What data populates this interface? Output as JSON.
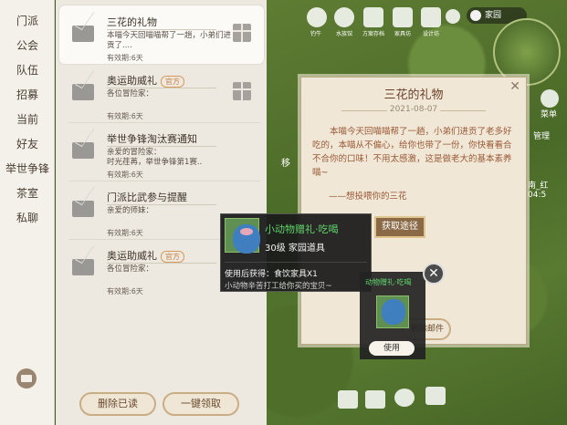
{
  "categories": [
    "门派",
    "公会",
    "队伍",
    "招募",
    "当前",
    "好友",
    "举世争锋",
    "茶室",
    "私聊"
  ],
  "mails": [
    {
      "title": "三花的礼物",
      "badge": "",
      "body": "本喵今天回喵喵帮了一趟，小弟们进贡了....",
      "expiry": "有效期:6天",
      "has_gift": true
    },
    {
      "title": "奥运助威礼",
      "badge": "官方",
      "body": "各位冒险家：",
      "expiry": "有效期:6天",
      "has_gift": true
    },
    {
      "title": "举世争锋淘汰赛通知",
      "badge": "",
      "body": "亲爱的冒险家：\n时光荏苒，举世争锋第1赛..",
      "expiry": "有效期:6天",
      "has_gift": false
    },
    {
      "title": "门派比武参与提醒",
      "badge": "",
      "body": "亲爱的师妹：",
      "expiry": "有效期:6天",
      "has_gift": false
    },
    {
      "title": "奥运助威礼",
      "badge": "官方",
      "body": "各位冒险家：",
      "expiry": "有效期:6天",
      "has_gift": false
    }
  ],
  "buttons": {
    "delete_read": "删除已读",
    "claim_all": "一键领取"
  },
  "hud": {
    "labels": [
      "钓牛",
      "水族馆",
      "方案存档",
      "家具坊",
      "设计坊",
      "菜单",
      "管理"
    ],
    "home_label": "家园"
  },
  "letter": {
    "title": "三花的礼物",
    "date": "2021-08-07",
    "body": "本喵今天回喵喵帮了一趟，小弟们进贡了老多好吃的，本喵从不偏心，给你也带了一份，你快看看合不合你的口味！不用太感激，这是做老大的基本素养喵~",
    "signature": "——想投喂你的三花",
    "delete_label": "删除邮件"
  },
  "tooltip": {
    "name": "小动物赠礼·吃喝",
    "level": "30级 家园道具",
    "use_effect": "使用后获得：食饮家具X1",
    "description": "小动物辛苦打工给你买的宝贝~",
    "obtain_label": "获取途径"
  },
  "attachment": {
    "title": "动物赠礼·吃喝",
    "use_label": "使用"
  },
  "overlays": {
    "left_text": "移",
    "right_text": "南_红 04:5"
  },
  "colors": {
    "accent_green": "#5fd46a",
    "letter_text": "#9a5a38",
    "badge_orange": "#c8803a"
  }
}
